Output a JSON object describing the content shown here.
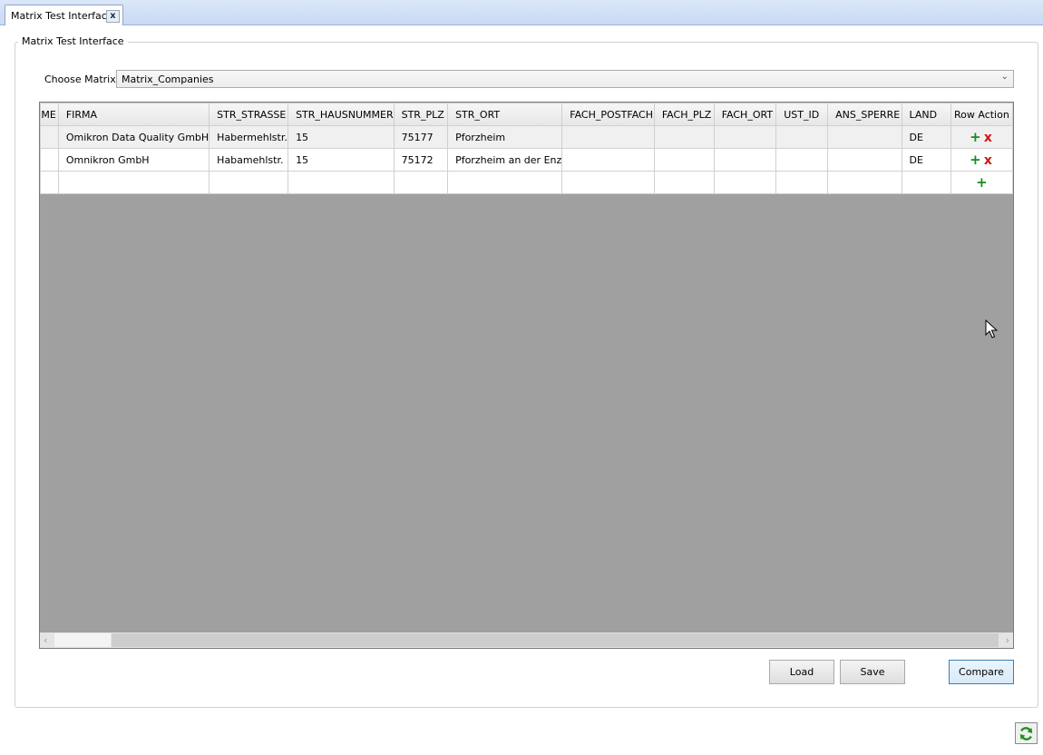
{
  "tab": {
    "title": "Matrix Test Interface",
    "close_label": "x"
  },
  "group": {
    "title": "Matrix Test Interface"
  },
  "matrix_select": {
    "label": "Choose Matrix:",
    "value": "Matrix_Companies"
  },
  "grid": {
    "columns": [
      "ME",
      "FIRMA",
      "STR_STRASSE",
      "STR_HAUSNUMMER",
      "STR_PLZ",
      "STR_ORT",
      "FACH_POSTFACH",
      "FACH_PLZ",
      "FACH_ORT",
      "UST_ID",
      "ANS_SPERRE",
      "LAND",
      "Row Action"
    ],
    "rows": [
      [
        "",
        "Omikron Data Quality GmbH",
        "Habermehlstr.",
        "15",
        "75177",
        "Pforzheim",
        "",
        "",
        "",
        "",
        "",
        "DE"
      ],
      [
        "",
        "Omnikron GmbH",
        "Habamehlstr.",
        "15",
        "75172",
        "Pforzheim an der Enz",
        "",
        "",
        "",
        "",
        "",
        "DE"
      ],
      [
        "",
        "",
        "",
        "",
        "",
        "",
        "",
        "",
        "",
        "",
        "",
        ""
      ]
    ],
    "row_actions": {
      "add": "+",
      "delete": "x"
    }
  },
  "buttons": {
    "load": "Load",
    "save": "Save",
    "compare": "Compare"
  },
  "icons": {
    "refresh": "refresh-icon",
    "add": "plus-icon",
    "delete": "delete-icon"
  },
  "colors": {
    "add": "#1a8a1a",
    "delete": "#d41414",
    "grid_background": "#a0a0a0"
  }
}
